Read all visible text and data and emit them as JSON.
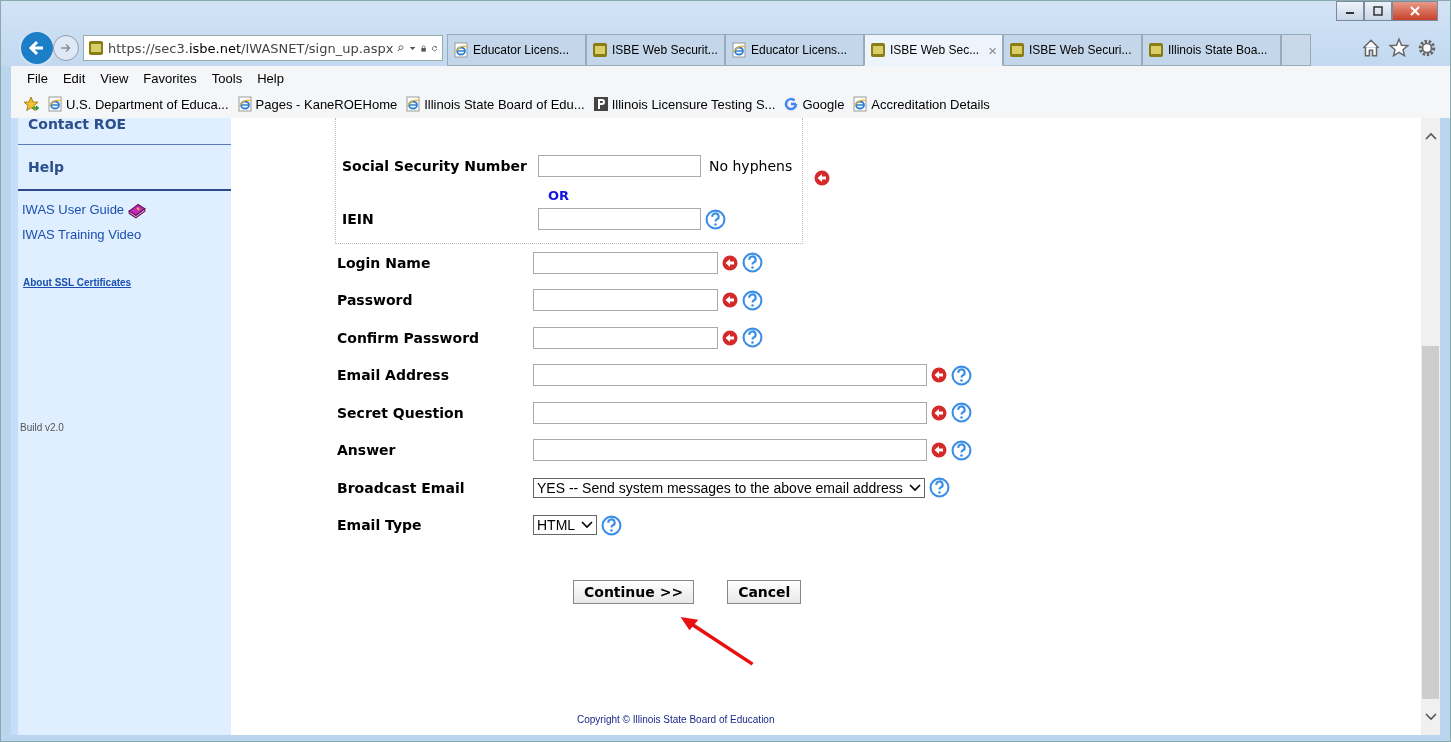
{
  "browser": {
    "url_parts": [
      {
        "text": "https://sec3.",
        "strong": false
      },
      {
        "text": "isbe.net",
        "strong": true
      },
      {
        "text": "/IWASNET/sign_up.aspx",
        "strong": false
      }
    ],
    "tabs": [
      {
        "label": "Educator Licens...",
        "kind": "ie",
        "selected": false
      },
      {
        "label": "ISBE Web Securit...",
        "kind": "isbe",
        "selected": false
      },
      {
        "label": "Educator Licens...",
        "kind": "ie",
        "selected": false
      },
      {
        "label": "ISBE Web Sec...",
        "kind": "isbe",
        "selected": true
      },
      {
        "label": "ISBE Web Securi...",
        "kind": "isbe",
        "selected": false
      },
      {
        "label": "Illinois State Boa...",
        "kind": "isbe",
        "selected": false
      }
    ],
    "tab_close": "×",
    "menu": [
      "File",
      "Edit",
      "View",
      "Favorites",
      "Tools",
      "Help"
    ],
    "favorites": [
      {
        "label": "U.S. Department of Educa...",
        "kind": "ie"
      },
      {
        "label": "Pages - KaneROEHome",
        "kind": "ie"
      },
      {
        "label": "Illinois State Board of Edu...",
        "kind": "ie"
      },
      {
        "label": "Illinois Licensure Testing S...",
        "kind": "p"
      },
      {
        "label": "Google",
        "kind": "g"
      },
      {
        "label": "Accreditation Details",
        "kind": "ie"
      }
    ]
  },
  "sidebar": {
    "headings": [
      "Contact ROE",
      "Help"
    ],
    "links": [
      "IWAS User Guide",
      "IWAS Training Video"
    ],
    "ssl_link": "About SSL Certificates",
    "build": "Build v2.0"
  },
  "id_group": {
    "fields": [
      {
        "label": "Social Security Number",
        "note": "No hyphens",
        "help": false
      },
      {
        "label": "IEIN",
        "help": true
      }
    ],
    "separator": "OR",
    "required": true
  },
  "fields": [
    {
      "label": "Login Name",
      "kind": "short_text",
      "required": true,
      "help": true
    },
    {
      "label": "Password",
      "kind": "short_text",
      "required": true,
      "help": true
    },
    {
      "label": "Confirm Password",
      "kind": "short_text",
      "required": true,
      "help": true
    },
    {
      "label": "Email Address",
      "kind": "long_text",
      "required": true,
      "help": true
    },
    {
      "label": "Secret Question",
      "kind": "long_text",
      "required": true,
      "help": true
    },
    {
      "label": "Answer",
      "kind": "long_text",
      "required": true,
      "help": true
    },
    {
      "label": "Broadcast Email",
      "kind": "select",
      "value": "YES -- Send system messages to the above email address",
      "required": false,
      "help": true
    },
    {
      "label": "Email Type",
      "kind": "select",
      "value": "HTML",
      "required": false,
      "help": true
    }
  ],
  "buttons": [
    "Continue >>",
    "Cancel"
  ],
  "footer": "Copyright © Illinois State Board of Education"
}
